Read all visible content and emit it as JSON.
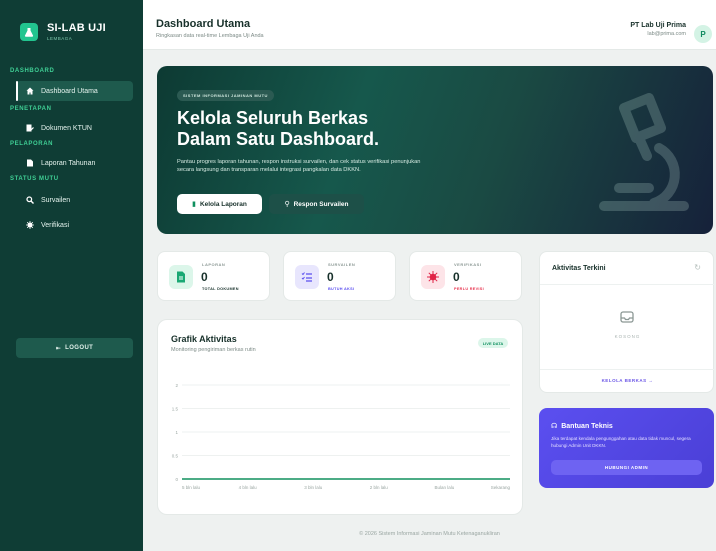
{
  "brand": {
    "name": "SI-LAB UJI",
    "sub": "LEMBAGA"
  },
  "sidebar": {
    "sections": [
      "DASHBOARD",
      "PENETAPAN",
      "PELAPORAN",
      "STATUS MUTU"
    ],
    "items": [
      {
        "label": "Dashboard Utama",
        "icon": "home-icon",
        "active": true
      },
      {
        "label": "Dokumen KTUN",
        "icon": "document-edit-icon"
      },
      {
        "label": "Laporan Tahunan",
        "icon": "file-icon"
      },
      {
        "label": "Survailen",
        "icon": "search-icon"
      },
      {
        "label": "Verifikasi",
        "icon": "virus-icon"
      }
    ],
    "logout": "LOGOUT"
  },
  "header": {
    "title": "Dashboard Utama",
    "subtitle": "Ringkasan data real-time Lembaga Uji Anda"
  },
  "user": {
    "name": "PT Lab Uji Prima",
    "email": "lab@prima.com",
    "initial": "P"
  },
  "hero": {
    "badge": "SISTEM INFORMASI JAMINAN MUTU",
    "title_line1": "Kelola Seluruh Berkas",
    "title_line2": "Dalam Satu Dashboard.",
    "desc_line1": "Pantau progres laporan tahunan, respon instruksi survailen, dan cek status verifikasi penunjukan",
    "desc_line2": "secara langsung dan transparan melalui integrasi pangkalan data DKKN.",
    "btn_primary": "Kelola Laporan",
    "btn_secondary": "Respon Survailen"
  },
  "stats": [
    {
      "label": "LAPORAN",
      "value": "0",
      "sub": "TOTAL DOKUMEN",
      "sub_color": "#17302a",
      "icon_bg": "#dcf6ea",
      "icon_color": "#1aa874"
    },
    {
      "label": "SURVAILEN",
      "value": "0",
      "sub": "BUTUH AKSI",
      "sub_color": "#5b4ff0",
      "icon_bg": "#e8e6fd",
      "icon_color": "#5b4ff0"
    },
    {
      "label": "VERIFIKASI",
      "value": "0",
      "sub": "PERLU REVISI",
      "sub_color": "#e8344f",
      "icon_bg": "#fde4e8",
      "icon_color": "#e02447"
    }
  ],
  "chart_card": {
    "title": "Grafik Aktivitas",
    "subtitle": "Monitoring pengiriman berkas rutin",
    "live": "LIVE DATA"
  },
  "chart_data": {
    "type": "line",
    "categories": [
      "5 bln lalu",
      "4 bln lalu",
      "3 bln lalu",
      "2 bln lalu",
      "Bulan lalu",
      "Sekarang"
    ],
    "series": [
      {
        "values": [
          0,
          0,
          0,
          0,
          0,
          0
        ]
      }
    ],
    "yticks": [
      "0",
      "0.5",
      "1",
      "1.5",
      "2"
    ],
    "ylim": [
      0,
      2
    ],
    "grid": true,
    "color": "#10905f"
  },
  "activity": {
    "title": "Aktivitas Terkini",
    "empty": "KOSONG",
    "link": "KELOLA BERKAS"
  },
  "help": {
    "title": "Bantuan Teknis",
    "desc": "Jika terdapat kendala pengunggahan atau data tidak muncul, segera hubungi Admin Unit DKKN.",
    "button": "HUBUNGI ADMIN"
  },
  "footer": "© 2026 Sistem Informasi Jaminan Mutu Ketenaganukliran"
}
